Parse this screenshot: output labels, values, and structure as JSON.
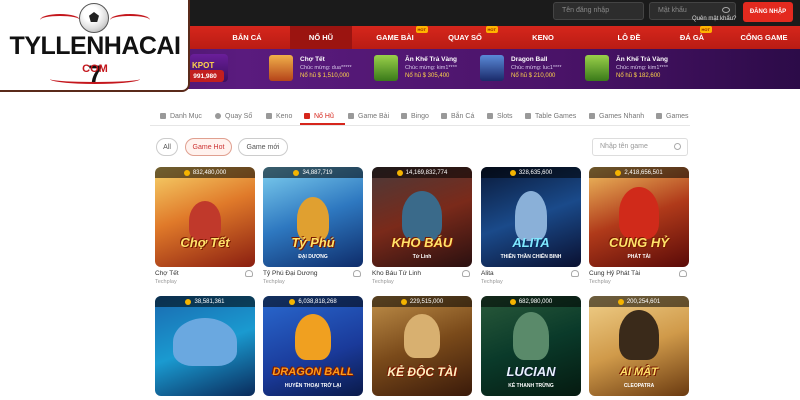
{
  "colors": {
    "brand_red": "#d6261c",
    "topbar": "#1b1b1b",
    "strip": "#4a1368",
    "gold": "#ffd54a"
  },
  "topbar": {
    "username_placeholder": "Tên đăng nhập",
    "password_placeholder": "Mật khẩu",
    "login_label": "ĐĂNG NHẬP",
    "forgot_label": "Quên mật khẩu?"
  },
  "logo": {
    "line1": "TYLLENHACAI 7",
    "line2": "COM"
  },
  "nav": [
    {
      "label": "BẮN CÁ",
      "hot": ""
    },
    {
      "label": "NỔ HŨ",
      "hot": ""
    },
    {
      "label": "GAME BÀI",
      "hot": "HOT"
    },
    {
      "label": "QUAY SỐ",
      "hot": "HOT"
    },
    {
      "label": "KENO",
      "hot": ""
    },
    {
      "label": "LÔ ĐỀ",
      "hot": ""
    },
    {
      "label": "ĐÁ GÀ",
      "hot": "HOT"
    },
    {
      "label": "CỔNG GAME",
      "hot": ""
    }
  ],
  "jackpot": {
    "label": "KPOT",
    "amount": "991,980"
  },
  "winners": [
    {
      "title": "Chợ Tết",
      "subtitle": "Chúc mừng: dua*****",
      "prize": "Nổ hũ $ 1,510,000"
    },
    {
      "title": "Ăn Khế Trả Vàng",
      "subtitle": "Chúc mừng: kim1****",
      "prize": "Nổ hũ $ 305,400"
    },
    {
      "title": "Dragon Ball",
      "subtitle": "Chúc mừng: luc1****",
      "prize": "Nổ hũ $ 210,000"
    },
    {
      "title": "Ăn Khế Trả Vàng",
      "subtitle": "Chúc mừng: kim1****",
      "prize": "Nổ hũ $ 182,600"
    }
  ],
  "categories": [
    "Danh Mục",
    "Quay Số",
    "Keno",
    "Nổ Hũ",
    "Game Bài",
    "Bingo",
    "Bắn Cá",
    "Slots",
    "Table Games",
    "Games Nhanh",
    "Games"
  ],
  "filters": [
    "All",
    "Game Hot",
    "Game mới"
  ],
  "search_placeholder": "Nhập tên game",
  "games": [
    {
      "name": "Chợ Tết",
      "provider": "Techplay",
      "amount": "832,480,000",
      "art_title": "Chợ Tết",
      "art_sub": ""
    },
    {
      "name": "Tỷ Phú Đại Dương",
      "provider": "Techplay",
      "amount": "34,887,719",
      "art_title": "Tỷ Phú",
      "art_sub": "ĐẠI DƯƠNG"
    },
    {
      "name": "Kho Báu Tứ Linh",
      "provider": "Techplay",
      "amount": "14,169,832,774",
      "art_title": "KHO BÁU",
      "art_sub": "Tứ Linh"
    },
    {
      "name": "Alita",
      "provider": "Techplay",
      "amount": "328,635,600",
      "art_title": "ALITA",
      "art_sub": "THIÊN THẦN CHIẾN BINH"
    },
    {
      "name": "Cung Hỷ Phát Tài",
      "provider": "Techplay",
      "amount": "2,418,656,501",
      "art_title": "CUNG HỶ",
      "art_sub": "PHÁT TÀI"
    },
    {
      "name": "",
      "provider": "",
      "amount": "38,581,361",
      "art_title": "",
      "art_sub": ""
    },
    {
      "name": "",
      "provider": "",
      "amount": "6,038,818,268",
      "art_title": "DRAGON BALL",
      "art_sub": "HUYỀN THOẠI TRỞ LẠI"
    },
    {
      "name": "",
      "provider": "",
      "amount": "229,515,000",
      "art_title": "KẺ ĐỘC TÀI",
      "art_sub": ""
    },
    {
      "name": "",
      "provider": "",
      "amount": "682,980,000",
      "art_title": "LUCIAN",
      "art_sub": "KẺ THANH TRỪNG"
    },
    {
      "name": "",
      "provider": "",
      "amount": "200,254,601",
      "art_title": "AI MẬT",
      "art_sub": "CLEOPATRA"
    }
  ]
}
